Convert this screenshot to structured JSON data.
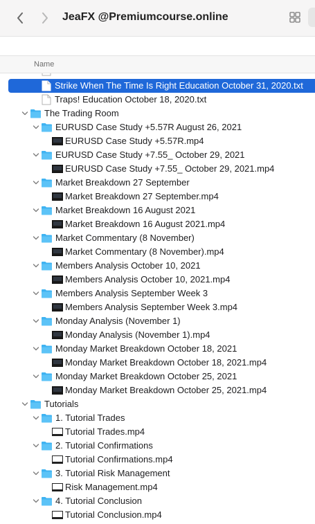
{
  "window": {
    "title": "JeaFX @Premiumcourse.online"
  },
  "columns": {
    "name": "Name"
  },
  "colors": {
    "selection": "#1f68d9",
    "folder": "#3fb3f2",
    "text": "#1d1d1f"
  },
  "rows": [
    {
      "label": "Strike When The Time Is Right  Education October 31, 2020.txt",
      "type": "txt",
      "depth": 1,
      "selected": true
    },
    {
      "label": "Traps!  Education October 18, 2020.txt",
      "type": "txt",
      "depth": 1
    },
    {
      "label": "The Trading Room",
      "type": "folder",
      "depth": 0,
      "expanded": true
    },
    {
      "label": "EURUSD Case Study +5.57R August 26, 2021",
      "type": "folder",
      "depth": 1,
      "expanded": true
    },
    {
      "label": "EURUSD Case Study +5.57R.mp4",
      "type": "video",
      "depth": 2
    },
    {
      "label": "EURUSD Case Study +7.55_ October 29, 2021",
      "type": "folder",
      "depth": 1,
      "expanded": true
    },
    {
      "label": "EURUSD Case Study +7.55_ October 29, 2021.mp4",
      "type": "video",
      "depth": 2
    },
    {
      "label": "Market Breakdown  27 September",
      "type": "folder",
      "depth": 1,
      "expanded": true
    },
    {
      "label": "Market Breakdown 27 September.mp4",
      "type": "video",
      "depth": 2
    },
    {
      "label": "Market Breakdown 16 August 2021",
      "type": "folder",
      "depth": 1,
      "expanded": true
    },
    {
      "label": "Market Breakdown 16 August 2021.mp4",
      "type": "video",
      "depth": 2
    },
    {
      "label": "Market Commentary (8 November)",
      "type": "folder",
      "depth": 1,
      "expanded": true
    },
    {
      "label": "Market Commentary (8 November).mp4",
      "type": "video",
      "depth": 2
    },
    {
      "label": "Members Analysis October 10, 2021",
      "type": "folder",
      "depth": 1,
      "expanded": true
    },
    {
      "label": "Members Analysis October 10, 2021.mp4",
      "type": "video",
      "depth": 2
    },
    {
      "label": "Members Analysis September Week 3",
      "type": "folder",
      "depth": 1,
      "expanded": true
    },
    {
      "label": "Members Analysis September Week 3.mp4",
      "type": "video",
      "depth": 2
    },
    {
      "label": "Monday Analysis (November 1)",
      "type": "folder",
      "depth": 1,
      "expanded": true
    },
    {
      "label": "Monday Analysis (November 1).mp4",
      "type": "video",
      "depth": 2
    },
    {
      "label": "Monday Market Breakdown October 18, 2021",
      "type": "folder",
      "depth": 1,
      "expanded": true
    },
    {
      "label": "Monday Market Breakdown October 18, 2021.mp4",
      "type": "video",
      "depth": 2
    },
    {
      "label": "Monday Market Breakdown October 25, 2021",
      "type": "folder",
      "depth": 1,
      "expanded": true
    },
    {
      "label": "Monday Market Breakdown October 25, 2021.mp4",
      "type": "video",
      "depth": 2
    },
    {
      "label": "Tutorials",
      "type": "folder",
      "depth": 0,
      "expanded": true
    },
    {
      "label": "1. Tutorial Trades",
      "type": "folder",
      "depth": 1,
      "expanded": true
    },
    {
      "label": "Tutorial Trades.mp4",
      "type": "video-light",
      "depth": 2
    },
    {
      "label": "2. Tutorial Confirmations",
      "type": "folder",
      "depth": 1,
      "expanded": true
    },
    {
      "label": "Tutorial Confirmations.mp4",
      "type": "video-light",
      "depth": 2
    },
    {
      "label": "3. Tutorial Risk Management",
      "type": "folder",
      "depth": 1,
      "expanded": true
    },
    {
      "label": "Risk Management.mp4",
      "type": "video-light",
      "depth": 2
    },
    {
      "label": "4. Tutorial Conclusion",
      "type": "folder",
      "depth": 1,
      "expanded": true
    },
    {
      "label": "Tutorial Conclusion.mp4",
      "type": "video-light",
      "depth": 2
    }
  ]
}
